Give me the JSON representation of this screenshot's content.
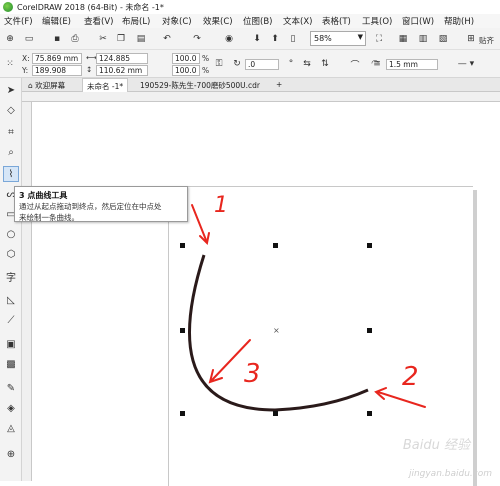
{
  "window": {
    "title": "CorelDRAW 2018 (64-Bit) - 未命名 -1*"
  },
  "menu": [
    "文件(F)",
    "编辑(E)",
    "查看(V)",
    "布局(L)",
    "对象(C)",
    "效果(C)",
    "位图(B)",
    "文本(X)",
    "表格(T)",
    "工具(O)",
    "窗口(W)",
    "帮助(H)"
  ],
  "toolbar": {
    "zoom": "58%",
    "snap_label": "贴齐"
  },
  "properties": {
    "x": "75.869 mm",
    "y": "189.908 mm",
    "width": "124.885 mm",
    "height": "110.62 mm",
    "scale_w": "100.0",
    "scale_h": "100.0",
    "pct": "%",
    "rotation": ".0",
    "outline": "1.5 mm",
    "x_label": "X:",
    "y_label": "Y:"
  },
  "tabs": [
    "欢迎屏幕",
    "未命名 -1*",
    "190529-陈先生-700磨砂500U.cdr"
  ],
  "tooltip": {
    "title": "3 点曲线工具",
    "body_line1": "通过从起点拖动到终点，然后定位在中点处",
    "body_line2": "来绘制一条曲线。"
  },
  "annotations": {
    "a1": "1",
    "a2": "2",
    "a3": "3"
  },
  "watermark": {
    "line1": "jingyan.baidu.com",
    "line2": "Baidu 经验"
  },
  "colors": {
    "annotation": "#e8261e",
    "curve": "#2a1a1a",
    "selected_tool": "#d6e6f7"
  }
}
